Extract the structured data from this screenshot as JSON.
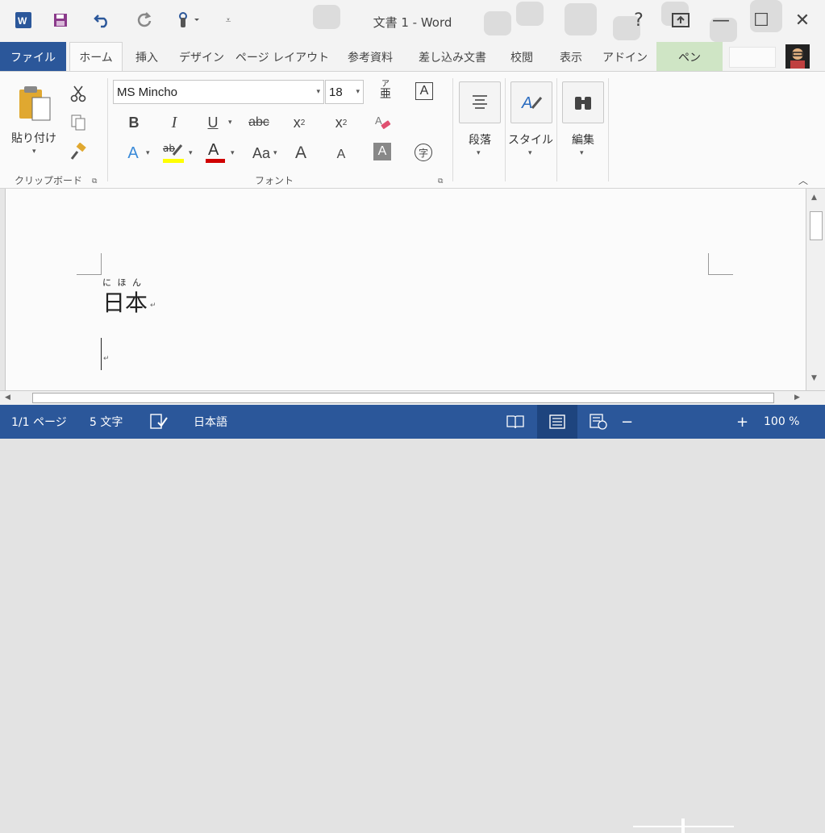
{
  "title_bar": {
    "doc_title": "文書 1 - Word",
    "help": "?",
    "minimize": "—",
    "maximize": "☐",
    "close": "✕"
  },
  "tabs": [
    {
      "label": "ファイル",
      "key": "file"
    },
    {
      "label": "ホーム",
      "key": "home",
      "active": true
    },
    {
      "label": "挿入",
      "key": "insert"
    },
    {
      "label": "デザイン",
      "key": "design"
    },
    {
      "label": "ページ レイアウト",
      "key": "layout"
    },
    {
      "label": "参考資料",
      "key": "references"
    },
    {
      "label": "差し込み文書",
      "key": "mailings"
    },
    {
      "label": "校閲",
      "key": "review"
    },
    {
      "label": "表示",
      "key": "view"
    },
    {
      "label": "アドイン",
      "key": "addins"
    },
    {
      "label": "ペン",
      "key": "pen"
    }
  ],
  "clipboard": {
    "paste_label": "貼り付け",
    "group_label": "クリップボード"
  },
  "font": {
    "font_name": "MS Mincho",
    "font_size": "18",
    "group_label": "フォント",
    "bold": "B",
    "italic": "I",
    "underline": "U",
    "strike": "abc",
    "subscript": "x",
    "subscript_sub": "2",
    "superscript": "x",
    "superscript_sup": "2",
    "phonetic_top": "ア",
    "phonetic_bottom": "亜",
    "char_border": "A",
    "text_effects": "A",
    "highlight": "ab",
    "font_color": "A",
    "change_case": "Aa",
    "grow": "A",
    "shrink": "A",
    "shading": "A",
    "enclose": "字"
  },
  "big_buttons": {
    "paragraph": "段落",
    "styles": "スタイル",
    "editing": "編集"
  },
  "document": {
    "ruby": "に ほ ん",
    "base_text": "日本",
    "para_mark": "↵"
  },
  "status": {
    "page": "1/1 ページ",
    "words": "5 文字",
    "language": "日本語",
    "zoom_minus": "−",
    "zoom_plus": "+",
    "zoom": "100 %",
    "zoom_level_percent": 100
  },
  "colors": {
    "accent": "#2b579a",
    "highlight_yellow": "#ffff00",
    "font_red": "#d00000",
    "pen_tab": "#cfe5c5"
  }
}
